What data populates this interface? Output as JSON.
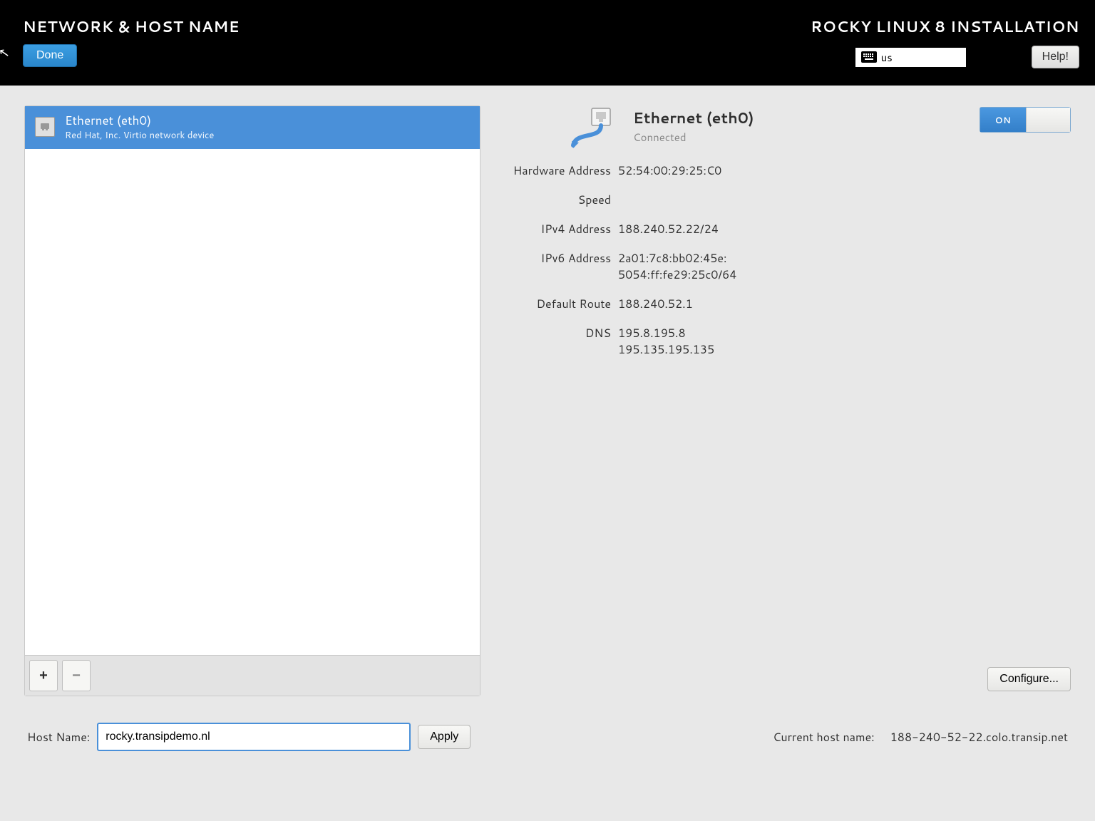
{
  "header": {
    "title": "NETWORK & HOST NAME",
    "done_label": "Done",
    "installer_title": "ROCKY LINUX 8 INSTALLATION",
    "keyboard_layout": "us",
    "help_label": "Help!"
  },
  "devices": {
    "items": [
      {
        "name": "Ethernet (eth0)",
        "description": "Red Hat, Inc. Virtio network device",
        "selected": true
      }
    ],
    "add_label": "+",
    "remove_label": "−"
  },
  "details": {
    "name": "Ethernet (eth0)",
    "status": "Connected",
    "toggle_on": true,
    "toggle_on_label": "ON",
    "fields": {
      "hardware_address": {
        "label": "Hardware Address",
        "value": "52:54:00:29:25:C0"
      },
      "speed": {
        "label": "Speed",
        "value": ""
      },
      "ipv4": {
        "label": "IPv4 Address",
        "value": "188.240.52.22/24"
      },
      "ipv6": {
        "label": "IPv6 Address",
        "value": "2a01:7c8:bb02:45e:\n5054:ff:fe29:25c0/64"
      },
      "default_route": {
        "label": "Default Route",
        "value": "188.240.52.1"
      },
      "dns": {
        "label": "DNS",
        "value": "195.8.195.8\n195.135.195.135"
      }
    },
    "configure_label": "Configure..."
  },
  "hostname": {
    "label": "Host Name:",
    "value": "rocky.transipdemo.nl",
    "apply_label": "Apply",
    "current_label": "Current host name:",
    "current_value": "188-240-52-22.colo.transip.net"
  }
}
